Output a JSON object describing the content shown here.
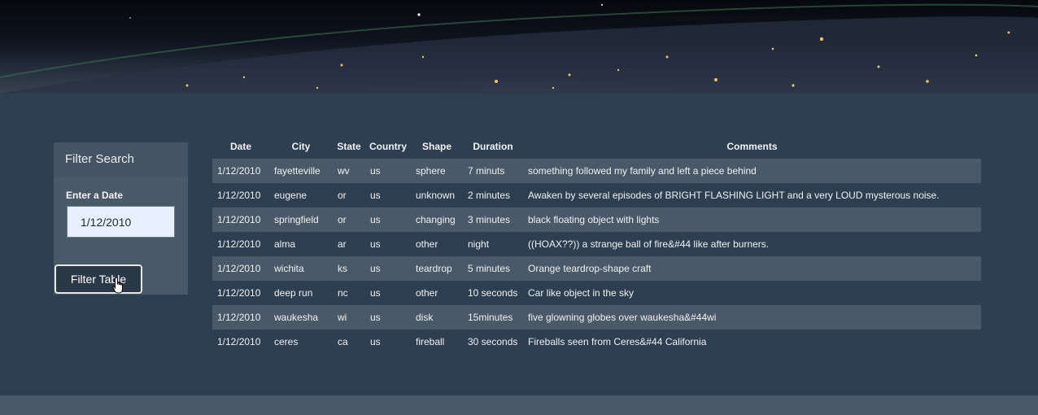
{
  "filter": {
    "title": "Filter Search",
    "date_label": "Enter a Date",
    "date_value": "1/12/2010",
    "button_label": "Filter Table"
  },
  "table": {
    "headers": [
      "Date",
      "City",
      "State",
      "Country",
      "Shape",
      "Duration",
      "Comments"
    ],
    "rows": [
      [
        "1/12/2010",
        "fayetteville",
        "wv",
        "us",
        "sphere",
        "7 minuts",
        "something followed my family and left a piece behind"
      ],
      [
        "1/12/2010",
        "eugene",
        "or",
        "us",
        "unknown",
        "2 minutes",
        "Awaken by several episodes of BRIGHT FLASHING LIGHT and a very LOUD mysterous noise."
      ],
      [
        "1/12/2010",
        "springfield",
        "or",
        "us",
        "changing",
        "3 minutes",
        "black floating object with lights"
      ],
      [
        "1/12/2010",
        "alma",
        "ar",
        "us",
        "other",
        "night",
        "((HOAX??)) a strange ball of fire&#44 like after burners."
      ],
      [
        "1/12/2010",
        "wichita",
        "ks",
        "us",
        "teardrop",
        "5 minutes",
        "Orange teardrop-shape craft"
      ],
      [
        "1/12/2010",
        "deep run",
        "nc",
        "us",
        "other",
        "10 seconds",
        "Car like object in the sky"
      ],
      [
        "1/12/2010",
        "waukesha",
        "wi",
        "us",
        "disk",
        "15minutes",
        "five glowning globes over waukesha&#44wi"
      ],
      [
        "1/12/2010",
        "ceres",
        "ca",
        "us",
        "fireball",
        "30 seconds",
        "Fireballs seen from Ceres&#44 California"
      ]
    ]
  }
}
